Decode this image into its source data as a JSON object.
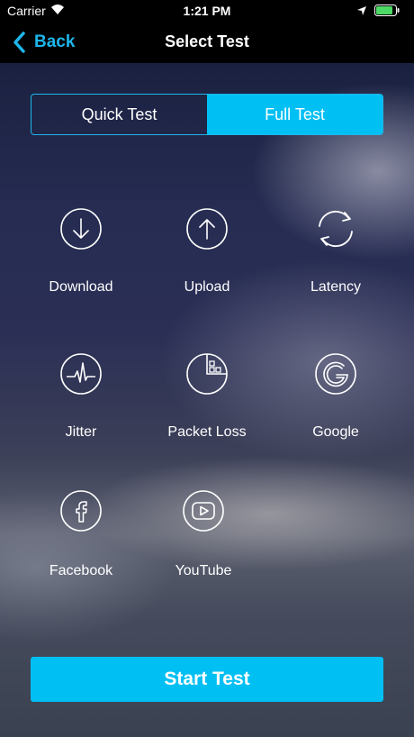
{
  "status_bar": {
    "carrier": "Carrier",
    "time": "1:21 PM"
  },
  "nav": {
    "back_label": "Back",
    "title": "Select Test"
  },
  "segments": [
    {
      "label": "Quick Test",
      "selected": false
    },
    {
      "label": "Full Test",
      "selected": true
    }
  ],
  "tests": [
    {
      "label": "Download",
      "icon": "download-icon"
    },
    {
      "label": "Upload",
      "icon": "upload-icon"
    },
    {
      "label": "Latency",
      "icon": "refresh-icon"
    },
    {
      "label": "Jitter",
      "icon": "heartbeat-icon"
    },
    {
      "label": "Packet Loss",
      "icon": "packet-loss-icon"
    },
    {
      "label": "Google",
      "icon": "google-icon"
    },
    {
      "label": "Facebook",
      "icon": "facebook-icon"
    },
    {
      "label": "YouTube",
      "icon": "youtube-icon"
    }
  ],
  "start_button": "Start Test",
  "colors": {
    "accent": "#00bff3",
    "back_text": "#1eb6ea",
    "bar": "#000000"
  }
}
